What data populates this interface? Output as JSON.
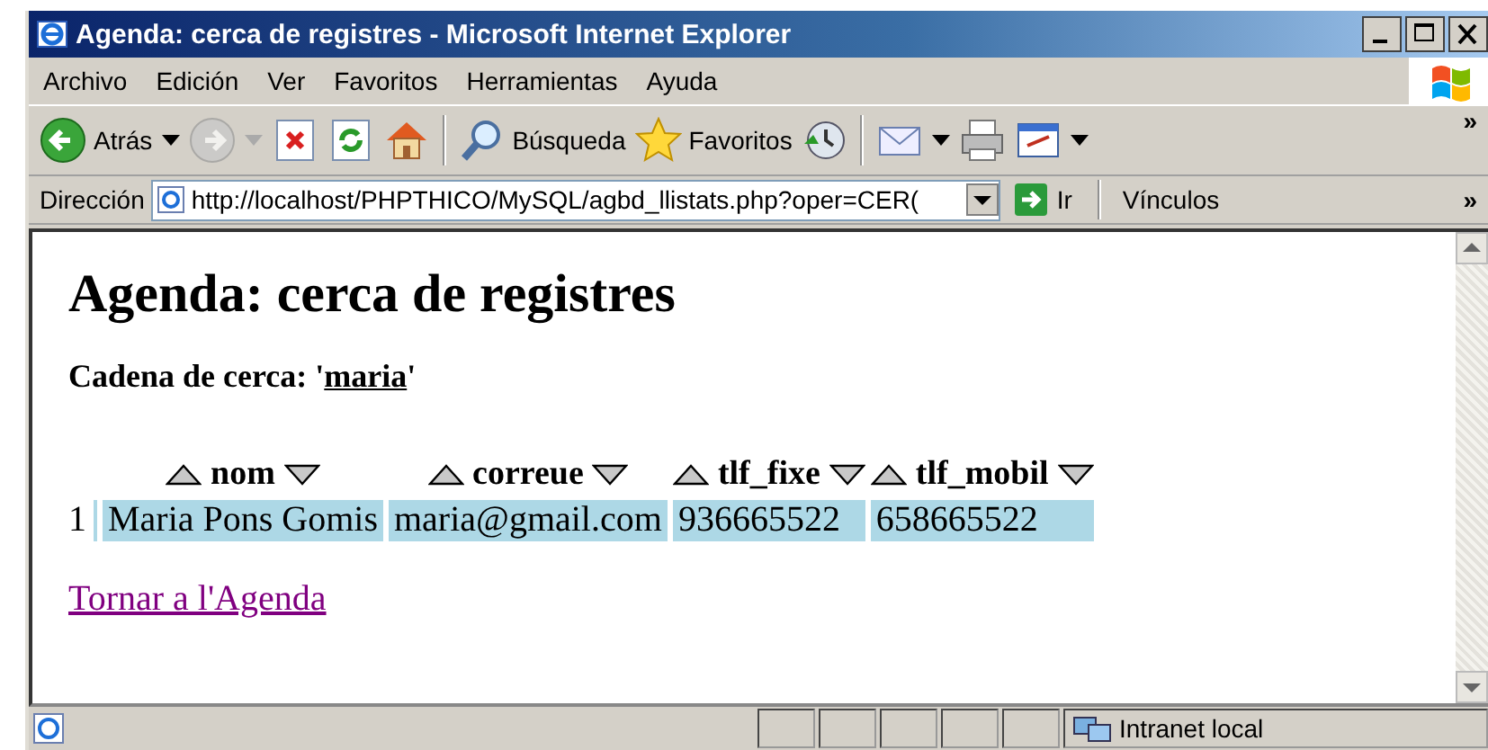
{
  "window": {
    "title": "Agenda: cerca de registres - Microsoft Internet Explorer"
  },
  "menu": [
    "Archivo",
    "Edición",
    "Ver",
    "Favoritos",
    "Herramientas",
    "Ayuda"
  ],
  "toolbar": [
    {
      "kind": "back",
      "label": "Atrás",
      "dropdown": true,
      "disabled": false
    },
    {
      "kind": "forward",
      "dropdown": true,
      "disabled": true
    },
    {
      "kind": "stop",
      "dropdown": false,
      "disabled": false
    },
    {
      "kind": "refresh",
      "dropdown": false,
      "disabled": false
    },
    {
      "kind": "home",
      "dropdown": false,
      "disabled": false
    },
    {
      "kind": "separator"
    },
    {
      "kind": "search",
      "label": "Búsqueda",
      "dropdown": false,
      "disabled": false
    },
    {
      "kind": "favorites",
      "label": "Favoritos",
      "dropdown": false,
      "disabled": false
    },
    {
      "kind": "history",
      "dropdown": false,
      "disabled": false
    },
    {
      "kind": "separator"
    },
    {
      "kind": "mail",
      "dropdown": true,
      "disabled": false
    },
    {
      "kind": "print",
      "dropdown": false,
      "disabled": false
    },
    {
      "kind": "edit",
      "dropdown": true,
      "disabled": false
    }
  ],
  "toolbar_more": "»",
  "address_bar": {
    "label": "Dirección",
    "url": "http://localhost/PHPTHICO/MySQL/agbd_llistats.php?oper=CER(",
    "go": "Ir",
    "links": "Vínculos",
    "links_more": "»"
  },
  "page": {
    "heading": "Agenda: cerca de registres",
    "search_line": {
      "prefix": "Cadena de cerca: '",
      "term": "maria",
      "suffix": "'"
    },
    "table": {
      "columns": [
        "nom",
        "correue",
        "tlf_fixe",
        "tlf_mobil"
      ],
      "rows": [
        {
          "number": "1",
          "cells": [
            "Maria Pons Gomis",
            "maria@gmail.com",
            "936665522",
            "658665522"
          ]
        }
      ]
    },
    "back_link": "Tornar a l'Agenda"
  },
  "status_bar": {
    "zone": "Intranet local"
  }
}
